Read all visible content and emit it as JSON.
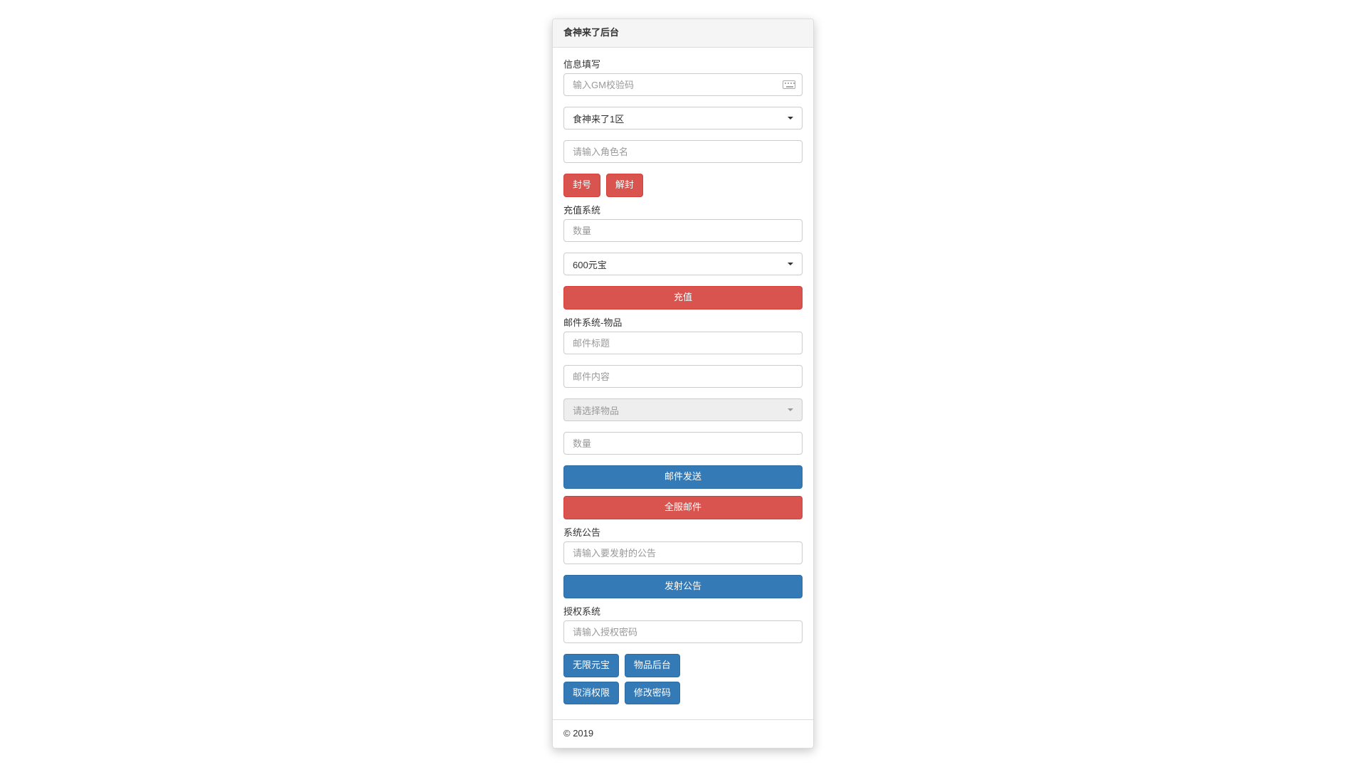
{
  "panel": {
    "title": "食神来了后台"
  },
  "info": {
    "label": "信息填写",
    "gm_placeholder": "输入GM校验码",
    "server_selected": "食神来了1区",
    "role_placeholder": "请输入角色名",
    "ban_label": "封号",
    "unban_label": "解封"
  },
  "recharge": {
    "label": "充值系统",
    "qty_placeholder": "数量",
    "option_selected": "600元宝",
    "submit_label": "充值"
  },
  "mail": {
    "label": "邮件系统-物品",
    "title_placeholder": "邮件标题",
    "content_placeholder": "邮件内容",
    "item_placeholder": "请选择物品",
    "qty_placeholder": "数量",
    "send_label": "邮件发送",
    "allserver_label": "全服邮件"
  },
  "announce": {
    "label": "系统公告",
    "placeholder": "请输入要发射的公告",
    "submit_label": "发射公告"
  },
  "auth": {
    "label": "授权系统",
    "placeholder": "请输入授权密码",
    "unlimited_label": "无限元宝",
    "item_backend_label": "物品后台",
    "cancel_perm_label": "取消权限",
    "change_pwd_label": "修改密码"
  },
  "footer": {
    "copyright": "© 2019"
  }
}
